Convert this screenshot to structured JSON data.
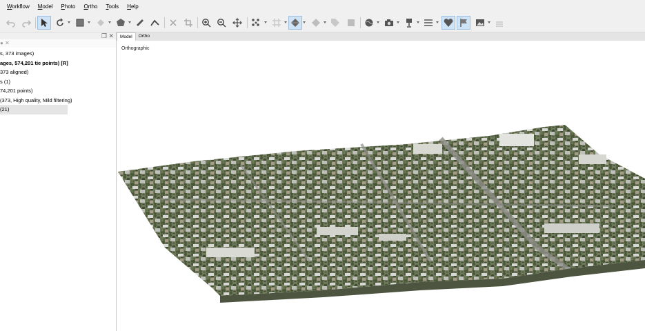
{
  "menu": [
    "Workflow",
    "Model",
    "Photo",
    "Ortho",
    "Tools",
    "Help"
  ],
  "toolbar": {
    "icons": [
      "undo-icon",
      "redo-icon",
      "select-arrow-icon",
      "rotate-icon",
      "rectangle-select-icon",
      "shape-icon",
      "polygon-icon",
      "ruler-icon",
      "draw-line-icon",
      "delete-icon",
      "crop-icon",
      "zoom-in-icon",
      "zoom-out-icon",
      "move-icon",
      "points-icon",
      "grid-icon",
      "model-view-icon",
      "shaded-view-icon",
      "tag-icon",
      "texture-icon",
      "globe-icon",
      "camera-icon",
      "cameras-icon",
      "list-icon",
      "heart-shape-icon",
      "flag-icon",
      "image-icon",
      "layers-icon"
    ]
  },
  "workspace": {
    "tree": [
      {
        "text": "s, 373 images)",
        "bold": false
      },
      {
        "text": "ages, 574,201 tie points) [R]",
        "bold": true
      },
      {
        "text": "373 aligned)",
        "bold": false
      },
      {
        "text": "s (1)",
        "bold": false
      },
      {
        "text": "74,201 points)",
        "bold": false
      },
      {
        "text": "(373, High quality, Mild filtering)",
        "bold": false
      },
      {
        "text": "(21)",
        "bold": false
      }
    ]
  },
  "tabs": [
    "Model",
    "Ortho"
  ],
  "viewport": {
    "view_mode": "Orthographic"
  },
  "colors": {
    "background": "#f0f0f0",
    "viewport_bg": "#ffffff",
    "pressed_button": "#cfe3f6"
  }
}
